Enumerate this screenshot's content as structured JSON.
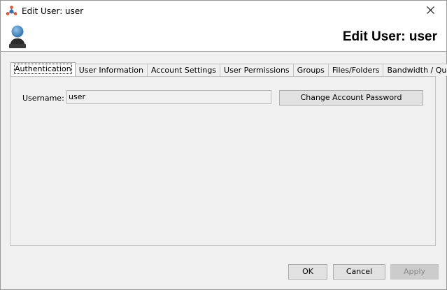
{
  "window": {
    "title": "Edit User: user",
    "app_icon": "app-logo-icon",
    "close_icon": "close-icon"
  },
  "header": {
    "title": "Edit User: user",
    "avatar_icon": "user-icon"
  },
  "tabs": [
    {
      "label": "Authentication",
      "active": true
    },
    {
      "label": "User Information",
      "active": false
    },
    {
      "label": "Account Settings",
      "active": false
    },
    {
      "label": "User Permissions",
      "active": false
    },
    {
      "label": "Groups",
      "active": false
    },
    {
      "label": "Files/Folders",
      "active": false
    },
    {
      "label": "Bandwidth / Quota",
      "active": false
    }
  ],
  "authentication": {
    "username_label": "Username:",
    "username_value": "user",
    "change_password_label": "Change Account Password"
  },
  "buttons": {
    "ok": "OK",
    "cancel": "Cancel",
    "apply": "Apply"
  },
  "colors": {
    "dialog_bg": "#f0f0f0",
    "button_bg": "#e1e1e1",
    "disabled_text": "#8a8a8a"
  }
}
